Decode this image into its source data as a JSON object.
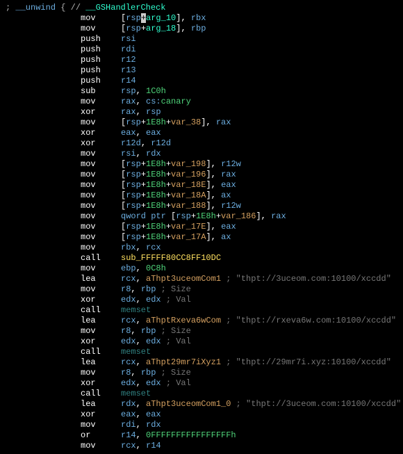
{
  "header": {
    "comment_prefix": "; ",
    "unwind": "__unwind",
    "brace": " { ",
    "comment_slashes": "// ",
    "handler": "__GSHandlerCheck"
  },
  "lines": [
    {
      "m": "mov",
      "ops": [
        {
          "t": "mem",
          "parts": [
            "[",
            "rsp",
            "+",
            "arg_10",
            "]"
          ]
        },
        {
          "t": "reg",
          "v": "rbx"
        }
      ]
    },
    {
      "m": "mov",
      "ops": [
        {
          "t": "mem",
          "parts": [
            "[",
            "rsp",
            "+",
            "arg_18",
            "]"
          ]
        },
        {
          "t": "reg",
          "v": "rbp"
        }
      ]
    },
    {
      "m": "push",
      "ops": [
        {
          "t": "reg",
          "v": "rsi"
        }
      ]
    },
    {
      "m": "push",
      "ops": [
        {
          "t": "reg",
          "v": "rdi"
        }
      ]
    },
    {
      "m": "push",
      "ops": [
        {
          "t": "reg",
          "v": "r12"
        }
      ]
    },
    {
      "m": "push",
      "ops": [
        {
          "t": "reg",
          "v": "r13"
        }
      ]
    },
    {
      "m": "push",
      "ops": [
        {
          "t": "reg",
          "v": "r14"
        }
      ]
    },
    {
      "m": "sub",
      "ops": [
        {
          "t": "reg",
          "v": "rsp"
        },
        {
          "t": "num",
          "v": "1C0h"
        }
      ]
    },
    {
      "m": "mov",
      "ops": [
        {
          "t": "reg",
          "v": "rax"
        },
        {
          "t": "glob",
          "v": "cs:",
          "g": "canary"
        }
      ]
    },
    {
      "m": "xor",
      "ops": [
        {
          "t": "reg",
          "v": "rax"
        },
        {
          "t": "reg",
          "v": "rsp"
        }
      ]
    },
    {
      "m": "mov",
      "ops": [
        {
          "t": "memv",
          "parts": [
            "[",
            "rsp",
            "+",
            "1E8h",
            "+",
            "var_38",
            "]"
          ]
        },
        {
          "t": "reg",
          "v": "rax"
        }
      ]
    },
    {
      "m": "xor",
      "ops": [
        {
          "t": "reg",
          "v": "eax"
        },
        {
          "t": "reg",
          "v": "eax"
        }
      ]
    },
    {
      "m": "xor",
      "ops": [
        {
          "t": "reg",
          "v": "r12d"
        },
        {
          "t": "reg",
          "v": "r12d"
        }
      ]
    },
    {
      "m": "mov",
      "ops": [
        {
          "t": "reg",
          "v": "rsi"
        },
        {
          "t": "reg",
          "v": "rdx"
        }
      ]
    },
    {
      "m": "mov",
      "ops": [
        {
          "t": "memv",
          "parts": [
            "[",
            "rsp",
            "+",
            "1E8h",
            "+",
            "var_198",
            "]"
          ]
        },
        {
          "t": "reg",
          "v": "r12w"
        }
      ]
    },
    {
      "m": "mov",
      "ops": [
        {
          "t": "memv",
          "parts": [
            "[",
            "rsp",
            "+",
            "1E8h",
            "+",
            "var_196",
            "]"
          ]
        },
        {
          "t": "reg",
          "v": "rax"
        }
      ]
    },
    {
      "m": "mov",
      "ops": [
        {
          "t": "memv",
          "parts": [
            "[",
            "rsp",
            "+",
            "1E8h",
            "+",
            "var_18E",
            "]"
          ]
        },
        {
          "t": "reg",
          "v": "eax"
        }
      ]
    },
    {
      "m": "mov",
      "ops": [
        {
          "t": "memv",
          "parts": [
            "[",
            "rsp",
            "+",
            "1E8h",
            "+",
            "var_18A",
            "]"
          ]
        },
        {
          "t": "reg",
          "v": "ax"
        }
      ]
    },
    {
      "m": "mov",
      "ops": [
        {
          "t": "memv",
          "parts": [
            "[",
            "rsp",
            "+",
            "1E8h",
            "+",
            "var_188",
            "]"
          ]
        },
        {
          "t": "reg",
          "v": "r12w"
        }
      ]
    },
    {
      "m": "mov",
      "ops": [
        {
          "t": "qmem",
          "kw": "qword ptr ",
          "parts": [
            "[",
            "rsp",
            "+",
            "1E8h",
            "+",
            "var_186",
            "]"
          ]
        },
        {
          "t": "reg",
          "v": "rax"
        }
      ]
    },
    {
      "m": "mov",
      "ops": [
        {
          "t": "memv",
          "parts": [
            "[",
            "rsp",
            "+",
            "1E8h",
            "+",
            "var_17E",
            "]"
          ]
        },
        {
          "t": "reg",
          "v": "eax"
        }
      ]
    },
    {
      "m": "mov",
      "ops": [
        {
          "t": "memv",
          "parts": [
            "[",
            "rsp",
            "+",
            "1E8h",
            "+",
            "var_17A",
            "]"
          ]
        },
        {
          "t": "reg",
          "v": "ax"
        }
      ]
    },
    {
      "m": "mov",
      "ops": [
        {
          "t": "reg",
          "v": "rbx"
        },
        {
          "t": "reg",
          "v": "rcx"
        }
      ]
    },
    {
      "m": "call",
      "ops": [
        {
          "t": "sub",
          "v": "sub_FFFFF80CC8FF10DC"
        }
      ]
    },
    {
      "m": "mov",
      "ops": [
        {
          "t": "reg",
          "v": "ebp"
        },
        {
          "t": "num",
          "v": "0C8h"
        }
      ]
    },
    {
      "m": "lea",
      "ops": [
        {
          "t": "reg",
          "v": "rcx"
        },
        {
          "t": "aName",
          "v": "aThpt3uceomCom1"
        }
      ],
      "cmt": "\"thpt://3uceom.com:10100/xccdd\""
    },
    {
      "m": "mov",
      "ops": [
        {
          "t": "reg",
          "v": "r8"
        },
        {
          "t": "reg",
          "v": "rbp"
        }
      ],
      "cmt": "Size"
    },
    {
      "m": "xor",
      "ops": [
        {
          "t": "reg",
          "v": "edx"
        },
        {
          "t": "reg",
          "v": "edx"
        }
      ],
      "cmt": "Val"
    },
    {
      "m": "call",
      "ops": [
        {
          "t": "name",
          "v": "memset"
        }
      ]
    },
    {
      "m": "lea",
      "ops": [
        {
          "t": "reg",
          "v": "rcx"
        },
        {
          "t": "aName",
          "v": "aThptRxeva6wCom"
        }
      ],
      "cmt": "\"thpt://rxeva6w.com:10100/xccdd\""
    },
    {
      "m": "mov",
      "ops": [
        {
          "t": "reg",
          "v": "r8"
        },
        {
          "t": "reg",
          "v": "rbp"
        }
      ],
      "cmt": "Size"
    },
    {
      "m": "xor",
      "ops": [
        {
          "t": "reg",
          "v": "edx"
        },
        {
          "t": "reg",
          "v": "edx"
        }
      ],
      "cmt": "Val"
    },
    {
      "m": "call",
      "ops": [
        {
          "t": "name",
          "v": "memset"
        }
      ]
    },
    {
      "m": "lea",
      "ops": [
        {
          "t": "reg",
          "v": "rcx"
        },
        {
          "t": "aName",
          "v": "aThpt29mr7iXyz1"
        }
      ],
      "cmt": "\"thpt://29mr7i.xyz:10100/xccdd\""
    },
    {
      "m": "mov",
      "ops": [
        {
          "t": "reg",
          "v": "r8"
        },
        {
          "t": "reg",
          "v": "rbp"
        }
      ],
      "cmt": "Size"
    },
    {
      "m": "xor",
      "ops": [
        {
          "t": "reg",
          "v": "edx"
        },
        {
          "t": "reg",
          "v": "edx"
        }
      ],
      "cmt": "Val"
    },
    {
      "m": "call",
      "ops": [
        {
          "t": "name",
          "v": "memset"
        }
      ]
    },
    {
      "m": "lea",
      "ops": [
        {
          "t": "reg",
          "v": "rdx"
        },
        {
          "t": "aName",
          "v": "aThpt3uceomCom1_0"
        }
      ],
      "cmt": "\"thpt://3uceom.com:10100/xccdd\""
    },
    {
      "m": "xor",
      "ops": [
        {
          "t": "reg",
          "v": "eax"
        },
        {
          "t": "reg",
          "v": "eax"
        }
      ]
    },
    {
      "m": "mov",
      "ops": [
        {
          "t": "reg",
          "v": "rdi"
        },
        {
          "t": "reg",
          "v": "rdx"
        }
      ]
    },
    {
      "m": "or",
      "ops": [
        {
          "t": "reg",
          "v": "r14"
        },
        {
          "t": "num",
          "v": "0FFFFFFFFFFFFFFFFh"
        }
      ]
    },
    {
      "m": "mov",
      "ops": [
        {
          "t": "reg",
          "v": "rcx"
        },
        {
          "t": "reg",
          "v": "r14"
        }
      ]
    }
  ]
}
